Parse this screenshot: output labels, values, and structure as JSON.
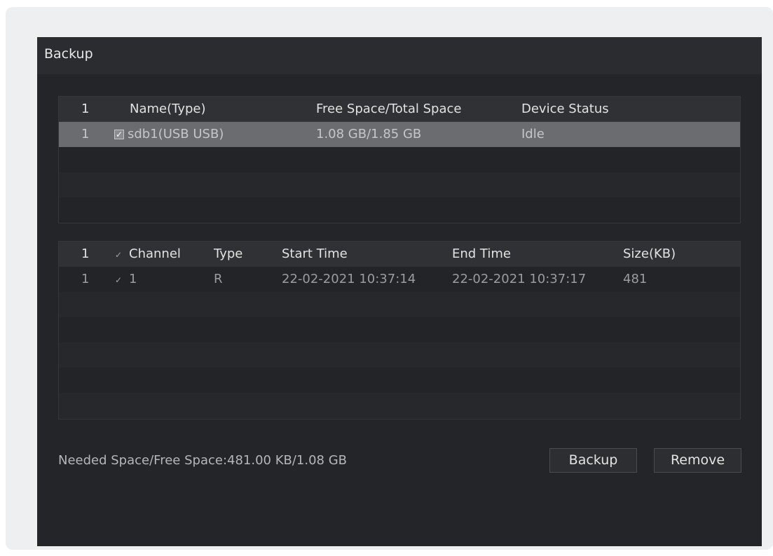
{
  "dialog": {
    "title": "Backup"
  },
  "devices": {
    "headers": {
      "num": "1",
      "name": "Name(Type)",
      "space": "Free Space/Total Space",
      "status": "Device Status"
    },
    "rows": [
      {
        "num": "1",
        "checked": true,
        "name": "sdb1(USB USB)",
        "space": "1.08 GB/1.85 GB",
        "status": "Idle"
      }
    ]
  },
  "files": {
    "headers": {
      "num": "1",
      "channel": "Channel",
      "type": "Type",
      "start": "Start Time",
      "end": "End Time",
      "size": "Size(KB)"
    },
    "rows": [
      {
        "num": "1",
        "channel": "1",
        "type": "R",
        "start": "22-02-2021 10:37:14",
        "end": "22-02-2021 10:37:17",
        "size": "481"
      }
    ]
  },
  "footer": {
    "space_info": "Needed Space/Free Space:481.00 KB/1.08 GB"
  },
  "buttons": {
    "backup": "Backup",
    "remove": "Remove"
  },
  "icons": {
    "check": "check-icon"
  }
}
